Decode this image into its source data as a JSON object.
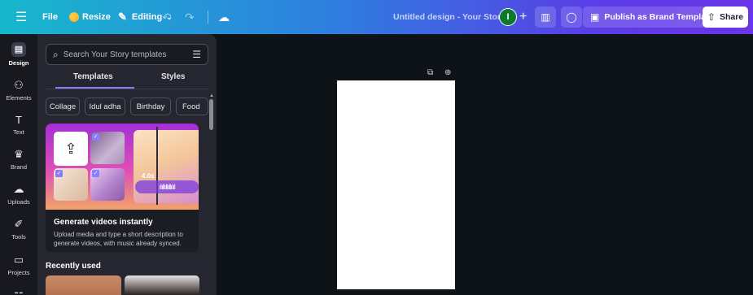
{
  "topbar": {
    "menu_icon": "hamburger-icon",
    "file_label": "File",
    "resize_label": "Resize",
    "editing_label": "Editing",
    "doc_title": "Untitled design - Your Story",
    "avatar_initial": "I",
    "publish_label": "Publish as Brand Template",
    "share_label": "Share"
  },
  "rail": {
    "items": [
      {
        "label": "Design",
        "icon": "design-icon"
      },
      {
        "label": "Elements",
        "icon": "elements-icon"
      },
      {
        "label": "Text",
        "icon": "text-icon"
      },
      {
        "label": "Brand",
        "icon": "brand-icon"
      },
      {
        "label": "Uploads",
        "icon": "uploads-icon"
      },
      {
        "label": "Tools",
        "icon": "tools-icon"
      },
      {
        "label": "Projects",
        "icon": "projects-icon"
      }
    ]
  },
  "panel": {
    "search_placeholder": "Search Your Story templates",
    "tabs": [
      {
        "label": "Templates",
        "active": true
      },
      {
        "label": "Styles",
        "active": false
      }
    ],
    "chips": [
      "Collage",
      "Idul adha",
      "Birthday",
      "Food"
    ],
    "promo": {
      "title": "Generate videos instantly",
      "description": "Upload media and type a short description to generate videos, with music already synced.",
      "time_badge": "4.0s"
    },
    "recently_used_title": "Recently used"
  },
  "colors": {
    "accent": "#8b7bff",
    "canvas_bg": "#0e1318",
    "panel_bg": "#252630"
  }
}
